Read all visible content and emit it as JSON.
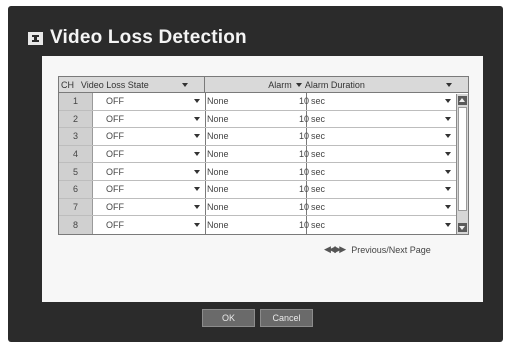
{
  "dialog": {
    "title": "Video Loss Detection",
    "icon": "menu-icon"
  },
  "table": {
    "headers": {
      "ch": "CH",
      "state": "Video Loss State",
      "alarm": "Alarm",
      "duration": "Alarm Duration"
    },
    "rows": [
      {
        "ch": "1",
        "state": "OFF",
        "alarm": "None",
        "duration_num": "10",
        "duration_unit": "sec"
      },
      {
        "ch": "2",
        "state": "OFF",
        "alarm": "None",
        "duration_num": "10",
        "duration_unit": "sec"
      },
      {
        "ch": "3",
        "state": "OFF",
        "alarm": "None",
        "duration_num": "10",
        "duration_unit": "sec"
      },
      {
        "ch": "4",
        "state": "OFF",
        "alarm": "None",
        "duration_num": "10",
        "duration_unit": "sec"
      },
      {
        "ch": "5",
        "state": "OFF",
        "alarm": "None",
        "duration_num": "10",
        "duration_unit": "sec"
      },
      {
        "ch": "6",
        "state": "OFF",
        "alarm": "None",
        "duration_num": "10",
        "duration_unit": "sec"
      },
      {
        "ch": "7",
        "state": "OFF",
        "alarm": "None",
        "duration_num": "10",
        "duration_unit": "sec"
      },
      {
        "ch": "8",
        "state": "OFF",
        "alarm": "None",
        "duration_num": "10",
        "duration_unit": "sec"
      }
    ]
  },
  "pager": {
    "icon": "◀◀ ▶▶",
    "label": "Previous/Next Page"
  },
  "buttons": {
    "ok": "OK",
    "cancel": "Cancel"
  }
}
